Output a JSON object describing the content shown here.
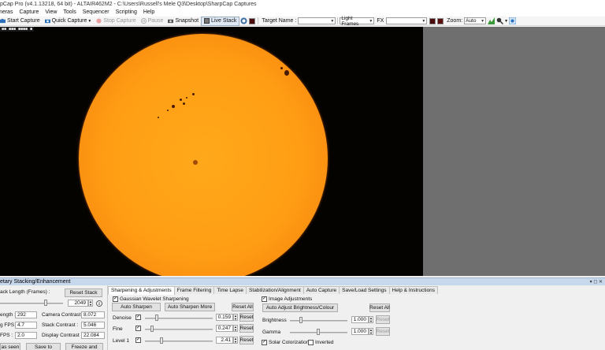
{
  "window": {
    "title": "pCap Pro (v4.1.13218, 64 bit) - ALTAIR462M2 - C:\\Users\\Russell's Mele Q3\\Desktop\\SharpCap Captures"
  },
  "menu": [
    "meras",
    "Capture",
    "View",
    "Tools",
    "Sequencer",
    "Scripting",
    "Help"
  ],
  "toolbar": {
    "start_capture": "Start Capture",
    "quick_capture": "Quick Capture",
    "stop_capture": "Stop Capture",
    "pause": "Pause",
    "snapshot": "Snapshot",
    "live_stack": "Live Stack",
    "target_name_label": "Target Name :",
    "light_frames": "Light Frames",
    "fx_label": "FX",
    "zoom_label": "Zoom:",
    "zoom_value": "Auto"
  },
  "viewport": {
    "overlay_text": "■■ ■■■ ■■■■ ■"
  },
  "panel": {
    "title": "etary Stacking/Enhancement",
    "controls": "▾ ◻ ✕"
  },
  "left": {
    "stack_length_label": "ack Length (Frames) :",
    "reset_stack": "Reset Stack",
    "stack_value": "2049",
    "length_label": "ength :",
    "length_value": "292",
    "camera_contrast_label": "Camera Contrast :",
    "camera_contrast_value": "8.072",
    "fps1_label": "g FPS :",
    "fps1_value": "4.7",
    "stack_contrast_label": "Stack Contrast :",
    "stack_contrast_value": "5.046",
    "fps2_label": "FPS :",
    "fps2_value": "2.0",
    "display_contrast_label": "Display Contrast :",
    "display_contrast_value": "22.084",
    "as_seen": "as seen",
    "save_to": "Save to",
    "freeze_and": "Freeze and"
  },
  "tabs": [
    "Sharpening & Adjustments",
    "Frame Filtering",
    "Time Lapse",
    "Stabilization/Alignment",
    "Auto Capture",
    "Save/Load Settings",
    "Help & Instructions"
  ],
  "sharpening": {
    "gaussian_label": "Gaussian Wavelet Sharpening",
    "auto_sharpen": "Auto Sharpen",
    "auto_sharpen_more": "Auto Sharpen More",
    "reset_all": "Reset All",
    "rows": [
      {
        "label": "Denoise",
        "value": "0.159",
        "reset": "Reset"
      },
      {
        "label": "Fine",
        "value": "0.247",
        "reset": "Reset"
      },
      {
        "label": "Level 1",
        "value": "2.41",
        "reset": "Reset"
      }
    ]
  },
  "adjust": {
    "image_adjustments": "Image Adjustments",
    "auto_adjust": "Auto Adjust Brightness/Colour",
    "reset_all": "Reset All",
    "brightness_label": "Brightness",
    "brightness_value": "1.000",
    "gamma_label": "Gamma",
    "gamma_value": "1.000",
    "reset": "Reset",
    "solar_colorization": "Solar Colorization",
    "inverted": "Inverted"
  }
}
